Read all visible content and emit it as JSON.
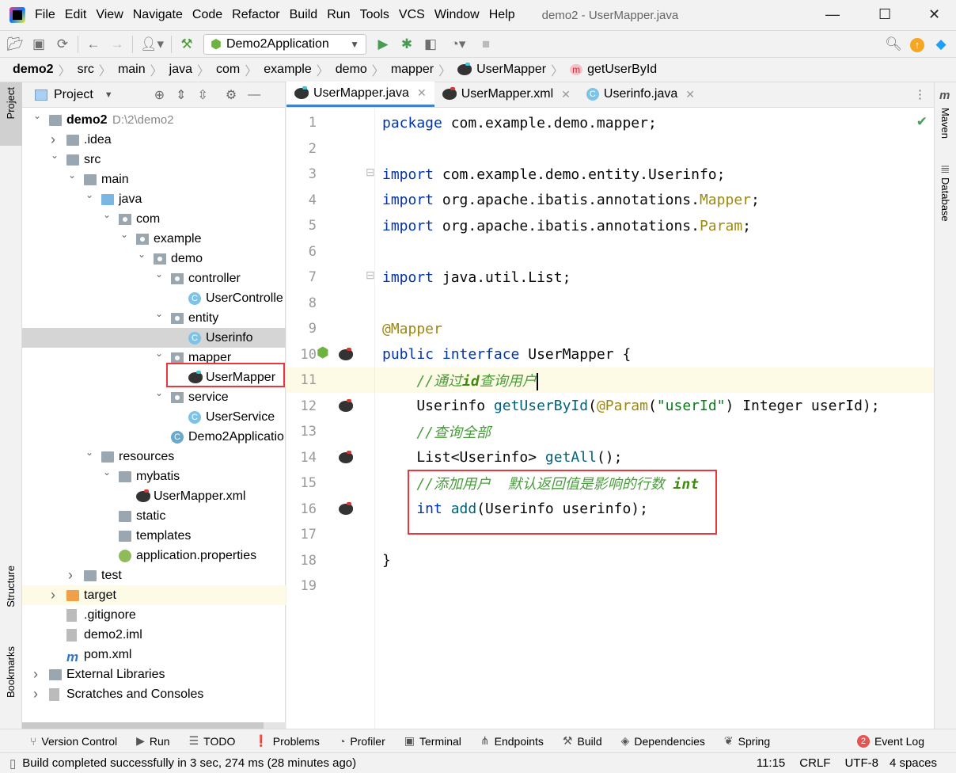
{
  "window": {
    "title": "demo2 - UserMapper.java",
    "menu": [
      "File",
      "Edit",
      "View",
      "Navigate",
      "Code",
      "Refactor",
      "Build",
      "Run",
      "Tools",
      "VCS",
      "Window",
      "Help"
    ]
  },
  "toolbar": {
    "run_config": "Demo2Application"
  },
  "breadcrumb": [
    "demo2",
    "src",
    "main",
    "java",
    "com",
    "example",
    "demo",
    "mapper",
    "UserMapper",
    "getUserById"
  ],
  "project": {
    "header": "Project",
    "tree": [
      {
        "level": 0,
        "name": "demo2",
        "hint": "D:\\2\\demo2",
        "arrow": "open",
        "icon": "module-folder",
        "bold": true
      },
      {
        "level": 1,
        "name": ".idea",
        "arrow": "closed",
        "icon": "folder"
      },
      {
        "level": 1,
        "name": "src",
        "arrow": "open",
        "icon": "folder"
      },
      {
        "level": 2,
        "name": "main",
        "arrow": "open",
        "icon": "folder"
      },
      {
        "level": 3,
        "name": "java",
        "arrow": "open",
        "icon": "source-folder"
      },
      {
        "level": 4,
        "name": "com",
        "arrow": "open",
        "icon": "package"
      },
      {
        "level": 5,
        "name": "example",
        "arrow": "open",
        "icon": "package"
      },
      {
        "level": 6,
        "name": "demo",
        "arrow": "open",
        "icon": "package"
      },
      {
        "level": 7,
        "name": "controller",
        "arrow": "open",
        "icon": "package"
      },
      {
        "level": 8,
        "name": "UserControlle",
        "icon": "class"
      },
      {
        "level": 7,
        "name": "entity",
        "arrow": "open",
        "icon": "package"
      },
      {
        "level": 8,
        "name": "Userinfo",
        "icon": "class",
        "selected": true
      },
      {
        "level": 7,
        "name": "mapper",
        "arrow": "open",
        "icon": "package"
      },
      {
        "level": 8,
        "name": "UserMapper",
        "icon": "mybatis-java",
        "boxed": true
      },
      {
        "level": 7,
        "name": "service",
        "arrow": "open",
        "icon": "package"
      },
      {
        "level": 8,
        "name": "UserService",
        "icon": "class"
      },
      {
        "level": 7,
        "name": "Demo2Applicatio",
        "icon": "spring-class"
      },
      {
        "level": 3,
        "name": "resources",
        "arrow": "open",
        "icon": "resources-folder"
      },
      {
        "level": 4,
        "name": "mybatis",
        "arrow": "open",
        "icon": "folder"
      },
      {
        "level": 5,
        "name": "UserMapper.xml",
        "icon": "mybatis-xml"
      },
      {
        "level": 4,
        "name": "static",
        "icon": "folder"
      },
      {
        "level": 4,
        "name": "templates",
        "icon": "folder"
      },
      {
        "level": 4,
        "name": "application.properties",
        "icon": "properties"
      },
      {
        "level": 2,
        "name": "test",
        "arrow": "closed",
        "icon": "folder"
      },
      {
        "level": 1,
        "name": "target",
        "arrow": "closed",
        "icon": "excluded-folder",
        "highlight": true
      },
      {
        "level": 1,
        "name": ".gitignore",
        "icon": "file"
      },
      {
        "level": 1,
        "name": "demo2.iml",
        "icon": "file"
      },
      {
        "level": 1,
        "name": "pom.xml",
        "icon": "maven"
      },
      {
        "level": 0,
        "name": "External Libraries",
        "arrow": "closed",
        "icon": "libraries"
      },
      {
        "level": 0,
        "name": "Scratches and Consoles",
        "arrow": "closed",
        "icon": "scratches"
      }
    ]
  },
  "editor": {
    "tabs": [
      {
        "label": "UserMapper.java",
        "active": true
      },
      {
        "label": "UserMapper.xml"
      },
      {
        "label": "Userinfo.java"
      }
    ],
    "lines": [
      [
        [
          "kw",
          "package "
        ],
        [
          "",
          "com.example.demo.mapper;"
        ]
      ],
      [],
      [
        [
          "kw",
          "import "
        ],
        [
          "",
          "com.example.demo.entity.Userinfo;"
        ]
      ],
      [
        [
          "kw",
          "import "
        ],
        [
          "",
          "org.apache.ibatis.annotations."
        ],
        [
          "an",
          "Mapper"
        ],
        [
          "",
          ";"
        ]
      ],
      [
        [
          "kw",
          "import "
        ],
        [
          "",
          "org.apache.ibatis.annotations."
        ],
        [
          "an",
          "Param"
        ],
        [
          "",
          ";"
        ]
      ],
      [],
      [
        [
          "kw",
          "import "
        ],
        [
          "",
          "java.util.List;"
        ]
      ],
      [],
      [
        [
          "an",
          "@Mapper"
        ]
      ],
      [
        [
          "kw",
          "public interface "
        ],
        [
          "",
          "UserMapper {"
        ]
      ],
      [
        [
          "cmc",
          "    //通过"
        ],
        [
          "cmk",
          "id"
        ],
        [
          "cmc",
          "查询用户"
        ]
      ],
      [
        [
          "",
          "    Userinfo "
        ],
        [
          "fn",
          "getUserById"
        ],
        [
          "",
          "("
        ],
        [
          "an",
          "@Param"
        ],
        [
          "",
          "("
        ],
        [
          "st",
          "\"userId\""
        ],
        [
          "",
          ") Integer userId);"
        ]
      ],
      [
        [
          "cmc",
          "    //查询全部"
        ]
      ],
      [
        [
          "",
          "    List<Userinfo> "
        ],
        [
          "fn",
          "getAll"
        ],
        [
          "",
          "();"
        ]
      ],
      [
        [
          "cmc",
          "    //添加用户  默认返回值是影响的行数 "
        ],
        [
          "cmk",
          "int"
        ]
      ],
      [
        [
          "kw",
          "    int "
        ],
        [
          "fn",
          "add"
        ],
        [
          "",
          "(Userinfo userinfo);"
        ]
      ],
      [],
      [
        [
          "",
          "}"
        ]
      ],
      []
    ],
    "current_line": 11
  },
  "side": {
    "left": [
      "Project",
      "Structure",
      "Bookmarks"
    ],
    "right": [
      "Maven",
      "Database"
    ]
  },
  "toolwindows": [
    {
      "icon": "vcs",
      "label": "Version Control"
    },
    {
      "icon": "run",
      "label": "Run"
    },
    {
      "icon": "todo",
      "label": "TODO"
    },
    {
      "icon": "problems",
      "label": "Problems"
    },
    {
      "icon": "profiler",
      "label": "Profiler"
    },
    {
      "icon": "terminal",
      "label": "Terminal"
    },
    {
      "icon": "endpoints",
      "label": "Endpoints"
    },
    {
      "icon": "build",
      "label": "Build"
    },
    {
      "icon": "dependencies",
      "label": "Dependencies"
    },
    {
      "icon": "spring",
      "label": "Spring"
    }
  ],
  "event_log": {
    "count": "2",
    "label": "Event Log"
  },
  "status": {
    "message": "Build completed successfully in 3 sec, 274 ms (28 minutes ago)",
    "position": "11:15",
    "line_sep": "CRLF",
    "encoding": "UTF-8",
    "indent": "4 spaces"
  }
}
